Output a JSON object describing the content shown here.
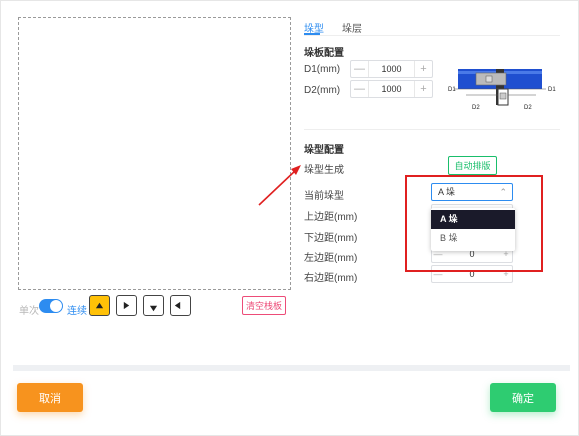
{
  "tabs": [
    {
      "label": "垛型",
      "active": true
    },
    {
      "label": "垛层",
      "active": false
    }
  ],
  "pallet_config": {
    "title": "垛板配置",
    "d1_label": "D1(mm)",
    "d1_value": "1000",
    "d2_label": "D2(mm)",
    "d2_value": "1000",
    "diagram_labels": {
      "d1_left": "D1",
      "d1_right": "D1",
      "d2_left": "D2",
      "d2_right": "D2"
    }
  },
  "stack_config": {
    "title": "垛型配置",
    "generate_label": "垛型生成",
    "auto_button": "自动排版",
    "current_label": "当前垛型",
    "current_value": "A 垛",
    "dropdown_options": [
      "A 垛",
      "B 垛"
    ],
    "selected_option": "A 垛",
    "margins": [
      {
        "label": "上边距(mm)",
        "value": "0"
      },
      {
        "label": "下边距(mm)",
        "value": "0"
      },
      {
        "label": "左边距(mm)",
        "value": "0"
      },
      {
        "label": "右边距(mm)",
        "value": "0"
      }
    ]
  },
  "controls": {
    "mode_left": "单次",
    "mode_right": "连续",
    "toggle_on": true,
    "clear_button": "清空栈板",
    "direction_buttons": [
      "up-arrow-icon",
      "right-arrow-icon",
      "down-arrow-icon",
      "left-arrow-icon"
    ]
  },
  "footer": {
    "cancel": "取消",
    "confirm": "确定"
  },
  "colors": {
    "accent": "#2d8cf0",
    "highlight": "#e02020",
    "cancel": "#f7931e",
    "confirm": "#2ecc71",
    "active_arrow": "#ffc107"
  }
}
